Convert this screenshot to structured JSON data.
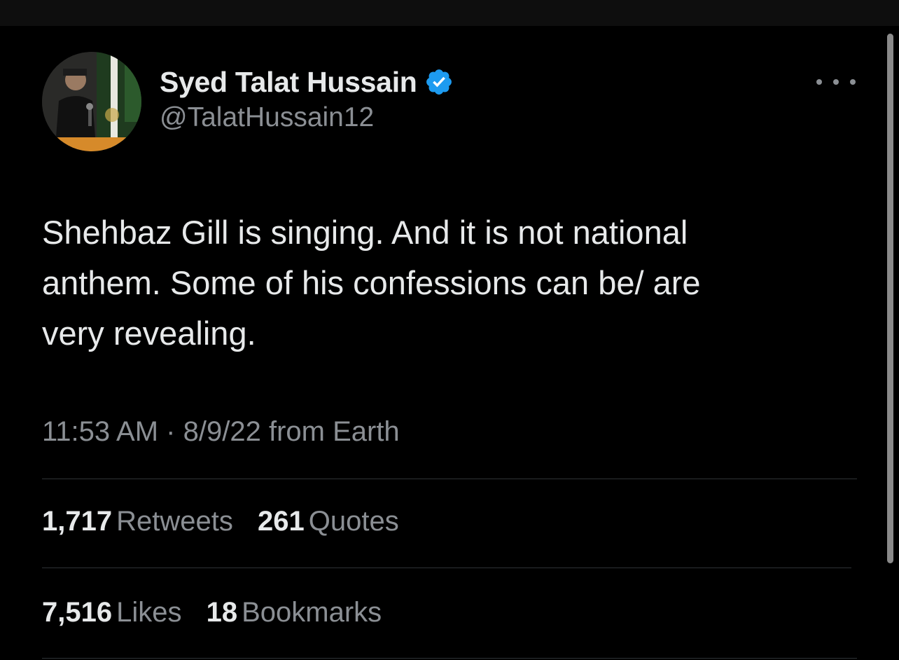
{
  "author": {
    "display_name": "Syed Talat Hussain",
    "handle": "@TalatHussain12",
    "verified": true
  },
  "tweet": {
    "lines": [
      "Shehbaz Gill is singing. And it is not national",
      "anthem. Some of his confessions can be/ are",
      "very revealing."
    ],
    "time": "11:53 AM",
    "date": "8/9/22",
    "source": "from Earth",
    "separator": "·"
  },
  "stats": {
    "row1": [
      {
        "value": "1,717",
        "label": "Retweets"
      },
      {
        "value": "261",
        "label": "Quotes"
      }
    ],
    "row2": [
      {
        "value": "7,516",
        "label": "Likes"
      },
      {
        "value": "18",
        "label": "Bookmarks"
      }
    ]
  },
  "colors": {
    "background": "#000000",
    "primary_text": "#e7e9ea",
    "secondary_text": "#8b8f94",
    "verified_badge": "#1d9bf0",
    "divider": "#2f3336"
  },
  "icons": {
    "verified": "verified-badge-icon",
    "more": "more-options-icon"
  }
}
